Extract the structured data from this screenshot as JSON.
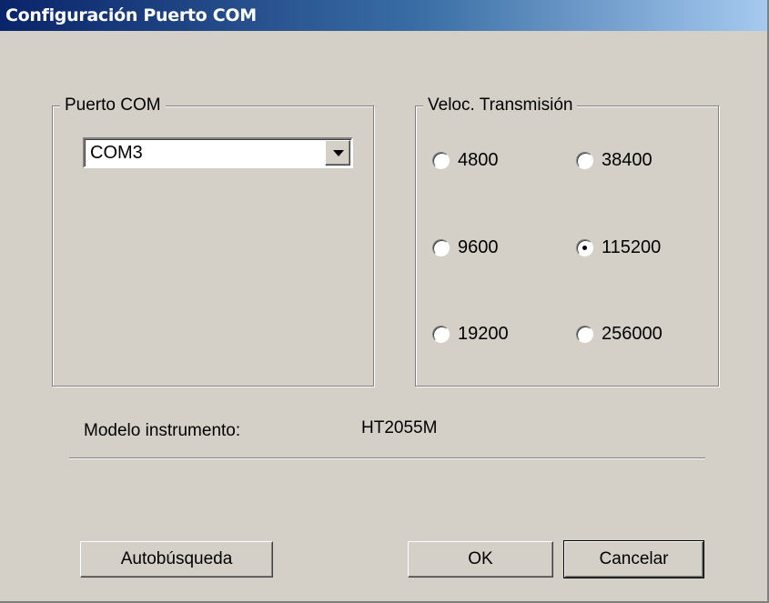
{
  "window": {
    "title": "Configuración Puerto COM"
  },
  "puerto_group": {
    "label": "Puerto COM",
    "combo": {
      "value": "COM3"
    }
  },
  "velocidad_group": {
    "label": "Veloc. Transmisión",
    "options": [
      {
        "label": "4800",
        "checked": false
      },
      {
        "label": "38400",
        "checked": false
      },
      {
        "label": "9600",
        "checked": false
      },
      {
        "label": "115200",
        "checked": true
      },
      {
        "label": "19200",
        "checked": false
      },
      {
        "label": "256000",
        "checked": false
      }
    ]
  },
  "info": {
    "model_label": "Modelo instrumento:",
    "model_value": "HT2055M"
  },
  "buttons": {
    "autosearch": "Autobúsqueda",
    "ok": "OK",
    "cancel": "Cancelar"
  }
}
